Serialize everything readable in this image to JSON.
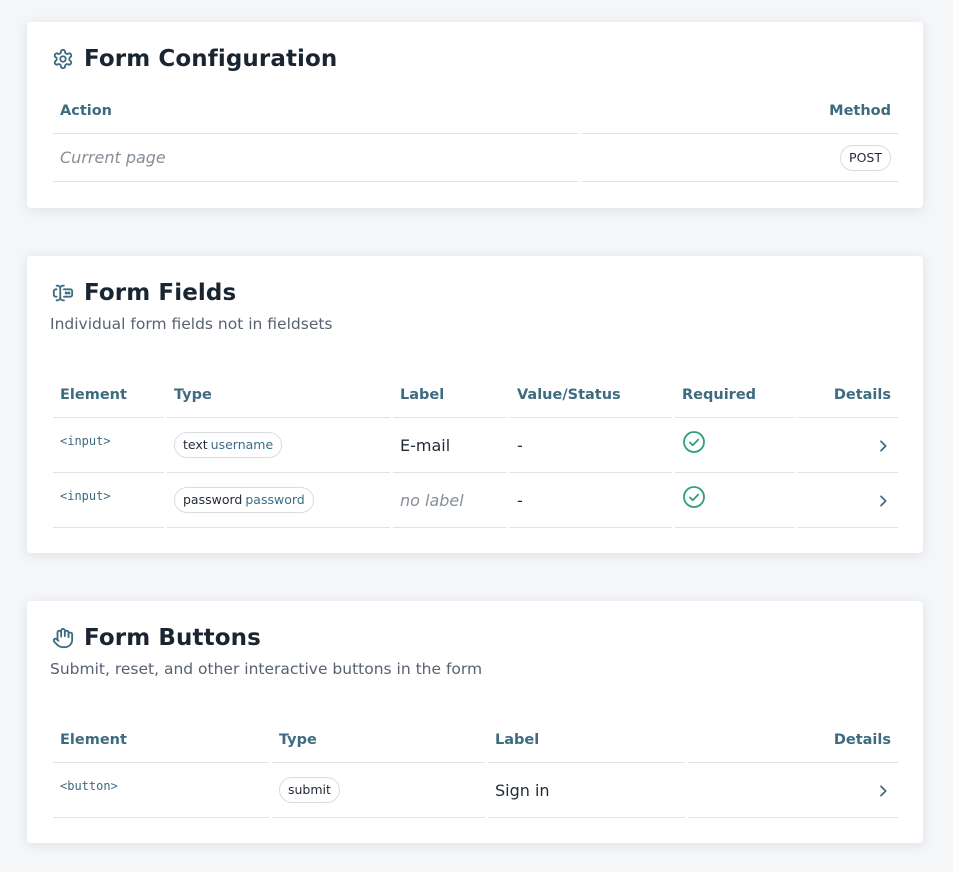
{
  "config": {
    "title": "Form Configuration",
    "icon": "gear-icon",
    "columns": [
      "Action",
      "Method"
    ],
    "action": "Current page",
    "method": "POST"
  },
  "fields": {
    "title": "Form Fields",
    "icon": "text-cursor-input-icon",
    "subtitle": "Individual form fields not in fieldsets",
    "columns": [
      "Element",
      "Type",
      "Label",
      "Value/Status",
      "Required",
      "Details"
    ],
    "rows": [
      {
        "element": "<input>",
        "type": "text",
        "name": "username",
        "label": "E-mail",
        "value": "-",
        "required": true
      },
      {
        "element": "<input>",
        "type": "password",
        "name": "password",
        "label": "no label",
        "value": "-",
        "required": true
      }
    ]
  },
  "buttons": {
    "title": "Form Buttons",
    "icon": "pointer-hand-icon",
    "subtitle": "Submit, reset, and other interactive buttons in the form",
    "columns": [
      "Element",
      "Type",
      "Label",
      "Details"
    ],
    "rows": [
      {
        "element": "<button>",
        "type": "submit",
        "label": "Sign in"
      }
    ]
  },
  "colors": {
    "accent": "#3d6b80",
    "success": "#2f9e7a",
    "muted": "#868e98"
  }
}
